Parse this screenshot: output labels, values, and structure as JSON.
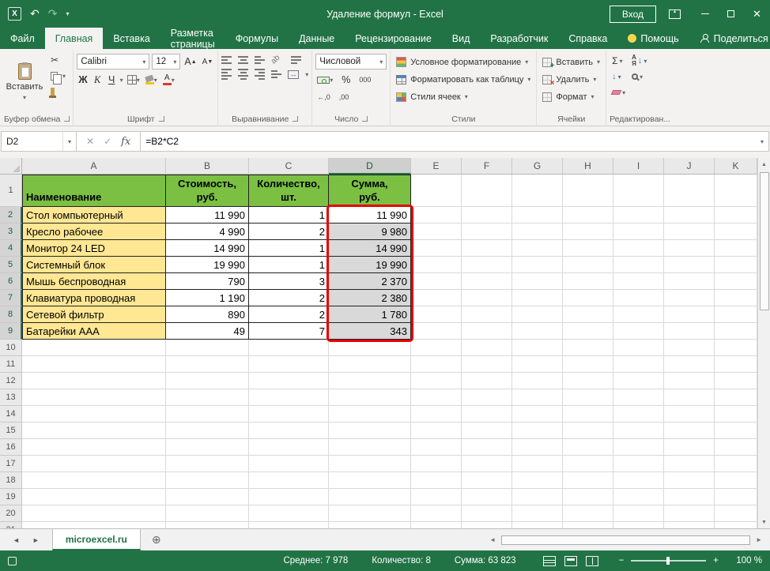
{
  "icons": {
    "dropdown": "▾",
    "undo": "↶",
    "redo": "↷",
    "scissors": "✂",
    "sigma": "Σ",
    "check": "✓",
    "cancel": "✕",
    "close": "✕",
    "fx": "fx",
    "plus_tab": "⊕",
    "left": "◄",
    "right": "►",
    "up": "▲",
    "down": "▼",
    "bold": "Ж",
    "italic": "К",
    "underline": "Ч",
    "font_bigger": "А",
    "font_smaller": "А",
    "font_color": "А",
    "rotate_ab": "ab",
    "merge_arrows": "↔",
    "percent": "%",
    "zeros": "000",
    "inc_decimal": "←,0",
    "dec_decimal": ",00",
    "fill_down": "↓",
    "sort_az": "А\nЯ",
    "sort_arrow": "↓",
    "ribbon_opt_arrow": "▲"
  },
  "title_bar": {
    "title": "Удаление формул - Excel",
    "sign_in": "Вход"
  },
  "ribbon_tabs": [
    {
      "id": "file",
      "label": "Файл",
      "file": true
    },
    {
      "id": "home",
      "label": "Главная",
      "active": true
    },
    {
      "id": "insert",
      "label": "Вставка"
    },
    {
      "id": "page-layout",
      "label": "Разметка страницы"
    },
    {
      "id": "formulas",
      "label": "Формулы"
    },
    {
      "id": "data",
      "label": "Данные"
    },
    {
      "id": "review",
      "label": "Рецензирование"
    },
    {
      "id": "view",
      "label": "Вид"
    },
    {
      "id": "developer",
      "label": "Разработчик"
    },
    {
      "id": "help",
      "label": "Справка"
    },
    {
      "id": "assistant",
      "label": "Помощь",
      "lightbulb": true
    }
  ],
  "share_label": "Поделиться",
  "ribbon": {
    "clipboard": {
      "paste": "Вставить",
      "group": "Буфер обмена"
    },
    "font": {
      "name": "Calibri",
      "size": "12",
      "group": "Шрифт"
    },
    "alignment": {
      "group": "Выравнивание"
    },
    "number": {
      "format": "Числовой",
      "group": "Число"
    },
    "styles": {
      "conditional": "Условное форматирование",
      "format_table": "Форматировать как таблицу",
      "cell_styles": "Стили ячеек",
      "group": "Стили"
    },
    "cells": {
      "insert": "Вставить",
      "delete": "Удалить",
      "format": "Формат",
      "group": "Ячейки"
    },
    "editing": {
      "group": "Редактирован..."
    }
  },
  "formula_bar": {
    "name_box": "D2",
    "formula": "=B2*C2"
  },
  "grid": {
    "columns": [
      "A",
      "B",
      "C",
      "D",
      "E",
      "F",
      "G",
      "H",
      "I",
      "J",
      "K"
    ],
    "selected_column": "D",
    "selected_rows_from": 2,
    "selected_rows_to": 9,
    "visible_rows": 20,
    "header_row": [
      "Наименование",
      "Стоимость,\nруб.",
      "Количество,\nшт.",
      "Сумма,\nруб."
    ],
    "data": [
      [
        "Стол компьютерный",
        "11 990",
        "1",
        "11 990"
      ],
      [
        "Кресло рабочее",
        "4 990",
        "2",
        "9 980"
      ],
      [
        "Монитор 24 LED",
        "14 990",
        "1",
        "14 990"
      ],
      [
        "Системный блок",
        "19 990",
        "1",
        "19 990"
      ],
      [
        "Мышь беспроводная",
        "790",
        "3",
        "2 370"
      ],
      [
        "Клавиатура проводная",
        "1 190",
        "2",
        "2 380"
      ],
      [
        "Сетевой фильтр",
        "890",
        "2",
        "1 780"
      ],
      [
        "Батарейки AAA",
        "49",
        "7",
        "343"
      ]
    ]
  },
  "sheet": {
    "tab": "microexcel.ru"
  },
  "status_bar": {
    "average": "Среднее: 7 978",
    "count": "Количество: 8",
    "sum": "Сумма: 63 823",
    "zoom": "100 %"
  }
}
